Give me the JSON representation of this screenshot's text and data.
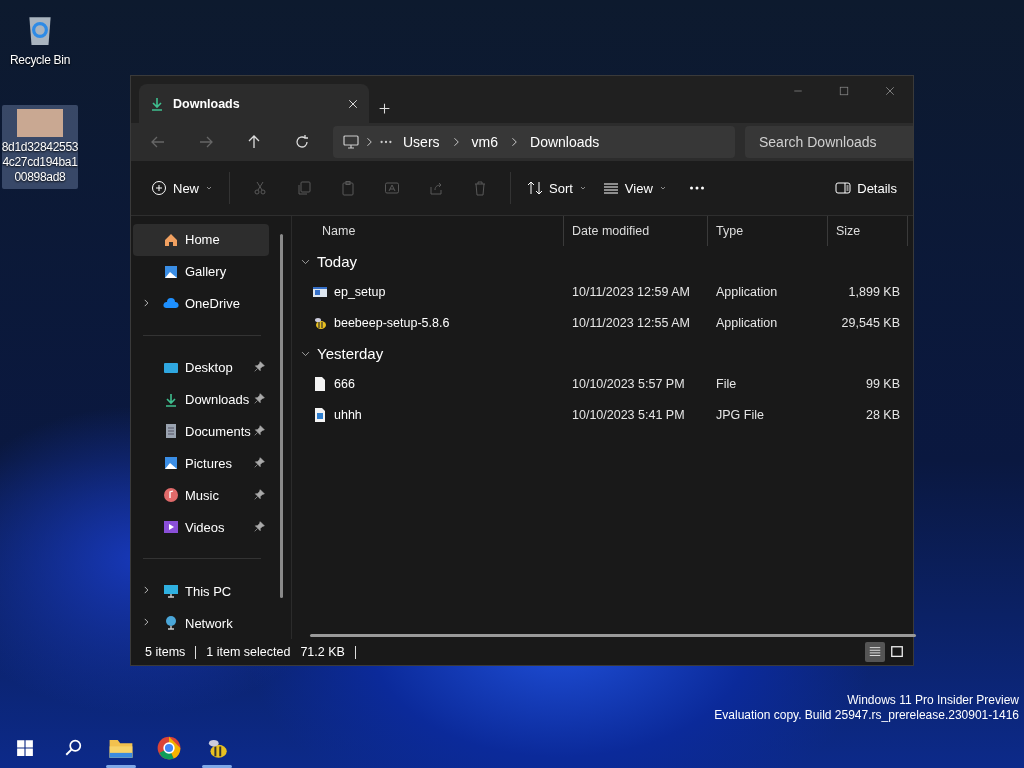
{
  "desktop_icons": [
    {
      "label": "Recycle Bin",
      "selected": false
    },
    {
      "label": "8d1d328425534c27cd194ba100898ad8",
      "selected": true
    }
  ],
  "window": {
    "tabs": [
      {
        "title": "Downloads",
        "selected": true
      }
    ],
    "nav": [
      {
        "disabled": true
      },
      {
        "disabled": true
      },
      {
        "disabled": false
      },
      {
        "disabled": false
      }
    ],
    "breadcrumbs": [
      "Users",
      "vm6",
      "Downloads"
    ],
    "search": {
      "placeholder": "Search Downloads"
    },
    "toolbar": [
      {
        "kind": "menu",
        "label": "New"
      },
      {
        "kind": "icon",
        "disabled": true
      },
      {
        "kind": "icon",
        "disabled": true
      },
      {
        "kind": "icon",
        "disabled": true
      },
      {
        "kind": "icon",
        "disabled": true
      },
      {
        "kind": "icon",
        "disabled": true
      },
      {
        "kind": "icon",
        "disabled": true
      },
      {
        "kind": "menu",
        "label": "Sort"
      },
      {
        "kind": "menu",
        "label": "View"
      },
      {
        "kind": "more"
      },
      {
        "kind": "details",
        "label": "Details"
      }
    ],
    "sidebar": {
      "groups": [
        [
          {
            "label": "Home",
            "selected": true,
            "expandable": false,
            "pinned": false
          },
          {
            "label": "Gallery",
            "selected": false,
            "expandable": false,
            "pinned": false
          },
          {
            "label": "OneDrive",
            "selected": false,
            "expandable": true,
            "pinned": false
          }
        ],
        [
          {
            "label": "Desktop",
            "selected": false,
            "expandable": false,
            "pinned": true
          },
          {
            "label": "Downloads",
            "selected": false,
            "expandable": false,
            "pinned": true
          },
          {
            "label": "Documents",
            "selected": false,
            "expandable": false,
            "pinned": true
          },
          {
            "label": "Pictures",
            "selected": false,
            "expandable": false,
            "pinned": true
          },
          {
            "label": "Music",
            "selected": false,
            "expandable": false,
            "pinned": true
          },
          {
            "label": "Videos",
            "selected": false,
            "expandable": false,
            "pinned": true
          }
        ],
        [
          {
            "label": "This PC",
            "selected": false,
            "expandable": true,
            "pinned": false
          },
          {
            "label": "Network",
            "selected": false,
            "expandable": true,
            "pinned": false
          }
        ]
      ]
    },
    "table": {
      "columns": [
        "Name",
        "Date modified",
        "Type",
        "Size"
      ],
      "groups": [
        {
          "label": "Today",
          "expanded": true,
          "rows": [
            {
              "kind": "app",
              "name": "ep_setup",
              "date": "10/11/2023 12:59 AM",
              "type": "Application",
              "size": "1,899 KB"
            },
            {
              "kind": "bee",
              "name": "beebeep-setup-5.8.6",
              "date": "10/11/2023 12:55 AM",
              "type": "Application",
              "size": "29,545 KB"
            }
          ]
        },
        {
          "label": "Yesterday",
          "expanded": true,
          "rows": [
            {
              "kind": "file",
              "name": "666",
              "date": "10/10/2023 5:57 PM",
              "type": "File",
              "size": "99 KB"
            },
            {
              "kind": "image",
              "name": "uhhh",
              "date": "10/10/2023 5:41 PM",
              "type": "JPG File",
              "size": "28 KB"
            }
          ]
        }
      ]
    },
    "status_bar": {
      "count": "5 items",
      "selection": "1 item selected",
      "size": "71.2 KB",
      "views": [
        {
          "selected": true
        },
        {
          "selected": false
        }
      ]
    }
  },
  "watermark": [
    "Windows 11 Pro Insider Preview",
    "Evaluation copy. Build 25947.rs_prerelease.230901-1416"
  ],
  "taskbar": [
    {
      "running": false
    },
    {
      "running": false
    },
    {
      "running": true
    },
    {
      "running": false
    },
    {
      "running": true
    }
  ]
}
